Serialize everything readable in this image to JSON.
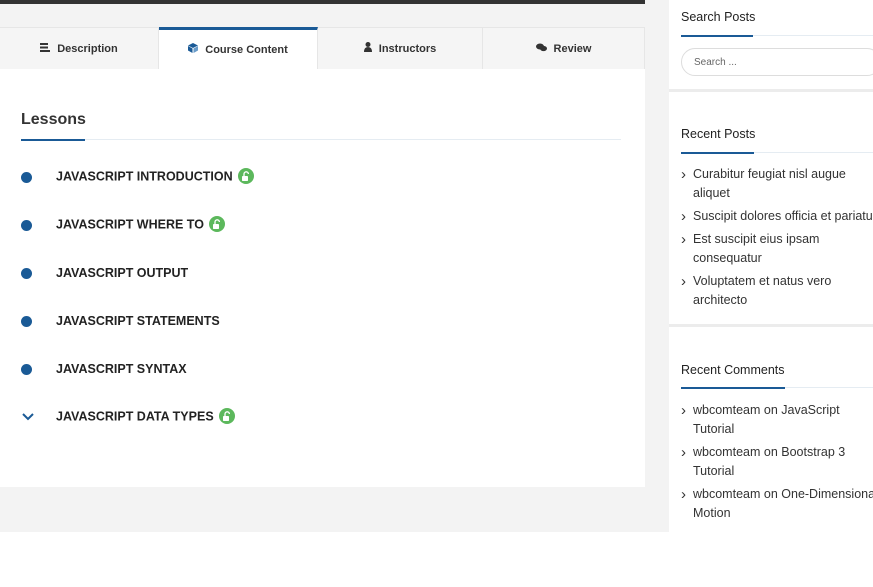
{
  "tabs": [
    {
      "label": "Description",
      "icon": "book-icon"
    },
    {
      "label": "Course Content",
      "icon": "cube-icon",
      "active": true
    },
    {
      "label": "Instructors",
      "icon": "user-icon"
    },
    {
      "label": "Review",
      "icon": "comments-icon"
    }
  ],
  "lessons": {
    "title": "Lessons",
    "items": [
      {
        "label": "JAVASCRIPT INTRODUCTION",
        "unlocked": true
      },
      {
        "label": "JAVASCRIPT WHERE TO",
        "unlocked": true
      },
      {
        "label": "JAVASCRIPT OUTPUT",
        "unlocked": false
      },
      {
        "label": "JAVASCRIPT STATEMENTS",
        "unlocked": false
      },
      {
        "label": "JAVASCRIPT SYNTAX",
        "unlocked": false
      },
      {
        "label": "JAVASCRIPT DATA TYPES",
        "unlocked": true,
        "expandable": true
      }
    ]
  },
  "sidebar": {
    "search": {
      "title": "Search Posts",
      "placeholder": "Search ..."
    },
    "recent_posts": {
      "title": "Recent Posts",
      "items": [
        "Curabitur feugiat nisl augue\naliquet",
        "Suscipit dolores officia et pariatur",
        "Est suscipit eius ipsam\nconsequatur",
        "Voluptatem et natus vero\narchitecto"
      ]
    },
    "recent_comments": {
      "title": "Recent Comments",
      "items": [
        {
          "author": "wbcomteam",
          "on": "on",
          "post": "JavaScript\nTutorial"
        },
        {
          "author": "wbcomteam",
          "on": "on",
          "post": "Bootstrap 3\nTutorial"
        },
        {
          "author": "wbcomteam",
          "on": "on",
          "post": "One-Dimensional\nMotion"
        }
      ]
    }
  },
  "colors": {
    "accent": "#1a5a96",
    "unlock": "#5cb85c"
  }
}
